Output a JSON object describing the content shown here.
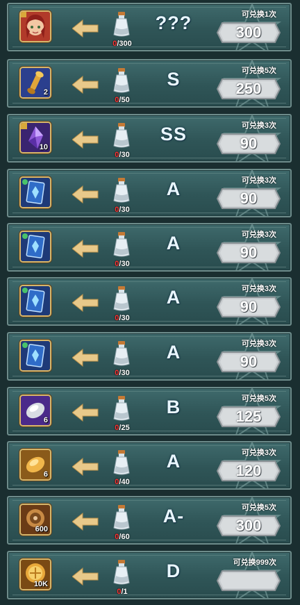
{
  "rows": [
    {
      "icon": "hero-portrait-icon",
      "icon_count": "",
      "progress_current": "0",
      "progress_total": "/300",
      "grade": "???",
      "limit": "可兑换1次",
      "cost": "300"
    },
    {
      "icon": "golden-scroll-icon",
      "icon_count": "2",
      "progress_current": "0",
      "progress_total": "/50",
      "grade": "S",
      "limit": "可兑换5次",
      "cost": "250"
    },
    {
      "icon": "purple-crystal-icon",
      "icon_count": "10",
      "progress_current": "0",
      "progress_total": "/30",
      "grade": "SS",
      "limit": "可兑换3次",
      "cost": "90"
    },
    {
      "icon": "blue-card-icon",
      "icon_count": "",
      "progress_current": "0",
      "progress_total": "/30",
      "grade": "A",
      "limit": "可兑换3次",
      "cost": "90"
    },
    {
      "icon": "blue-card-icon",
      "icon_count": "",
      "progress_current": "0",
      "progress_total": "/30",
      "grade": "A",
      "limit": "可兑换3次",
      "cost": "90"
    },
    {
      "icon": "blue-card-icon",
      "icon_count": "",
      "progress_current": "0",
      "progress_total": "/30",
      "grade": "A",
      "limit": "可兑换3次",
      "cost": "90"
    },
    {
      "icon": "blue-card-icon",
      "icon_count": "",
      "progress_current": "0",
      "progress_total": "/30",
      "grade": "A",
      "limit": "可兑换3次",
      "cost": "90"
    },
    {
      "icon": "silver-gem-icon",
      "icon_count": "6",
      "progress_current": "0",
      "progress_total": "/25",
      "grade": "B",
      "limit": "可兑换5次",
      "cost": "125"
    },
    {
      "icon": "gold-gem-icon",
      "icon_count": "6",
      "progress_current": "0",
      "progress_total": "/40",
      "grade": "A",
      "limit": "可兑换3次",
      "cost": "120"
    },
    {
      "icon": "gear-coin-icon",
      "icon_count": "600",
      "progress_current": "0",
      "progress_total": "/60",
      "grade": "A-",
      "limit": "可兑换5次",
      "cost": "300"
    },
    {
      "icon": "gold-coin-icon",
      "icon_count": "10K",
      "progress_current": "0",
      "progress_total": "/1",
      "grade": "D",
      "limit": "可兑换999次",
      "cost": ""
    }
  ],
  "colors": {
    "row_bg": "#2f5557",
    "row_border": "#6e8c8b",
    "icon_frame": "#d6b56a",
    "arrow": "#e8c98a",
    "progress_current": "#ff3030",
    "grade_text": "#e9f6ff",
    "badge": "#c9cdd0"
  }
}
